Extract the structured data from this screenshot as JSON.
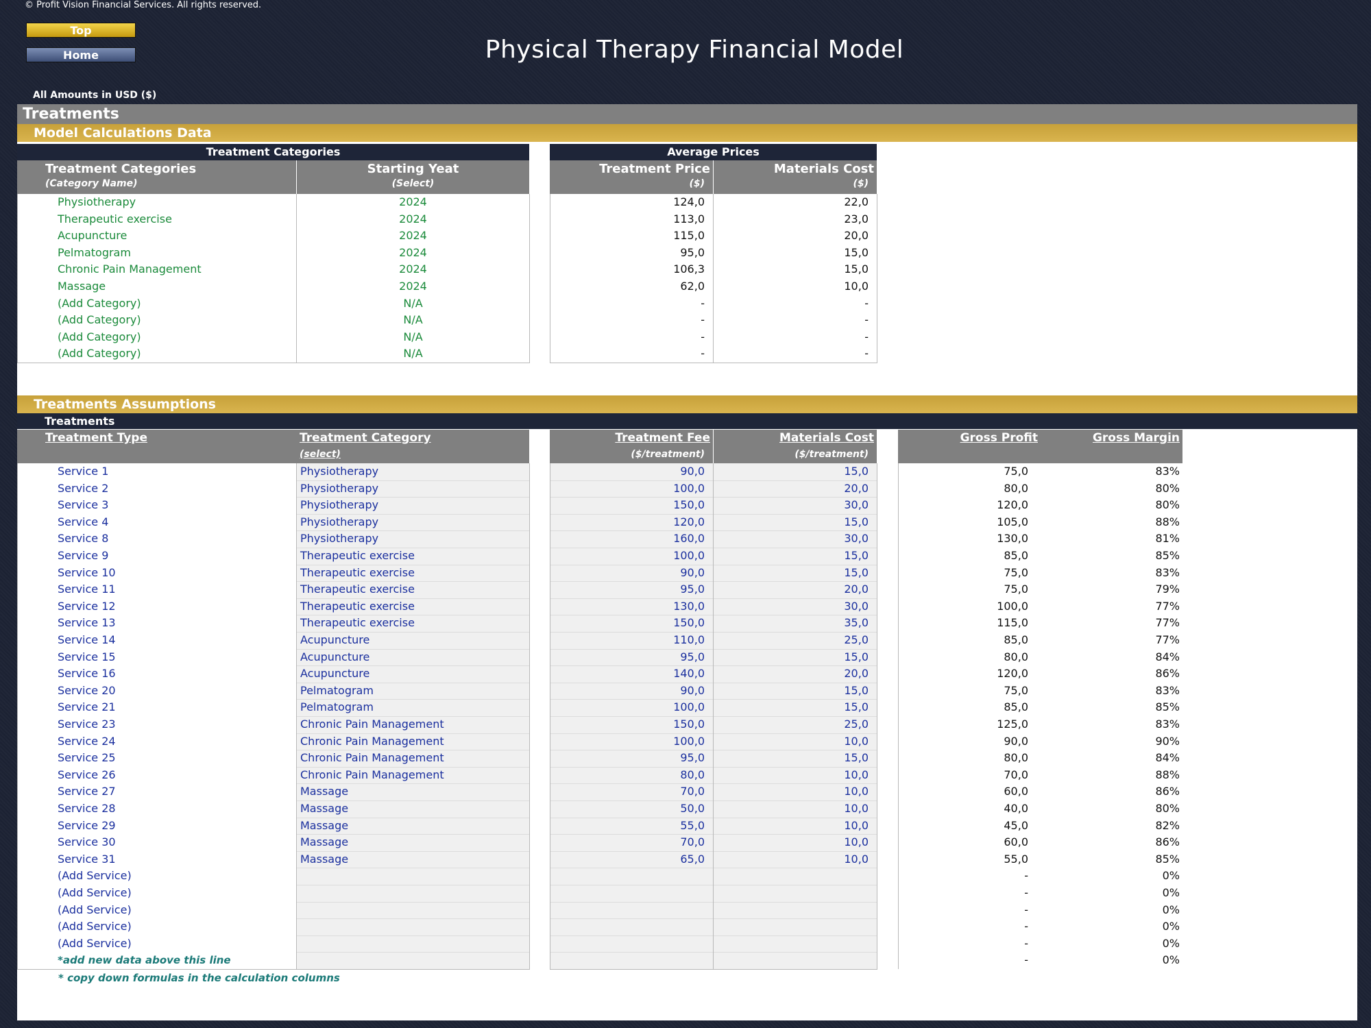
{
  "copyright": "© Profit Vision Financial Services. All rights reserved.",
  "nav": {
    "top_label": "Top",
    "home_label": "Home"
  },
  "title": "Physical Therapy Financial Model",
  "amounts_note": "All Amounts in  USD ($)",
  "section_title": "Treatments",
  "model_calc": {
    "bar_label": "Model Calculations Data",
    "group_categories": "Treatment Categories",
    "group_prices": "Average Prices",
    "col_category": "Treatment Categories",
    "col_category_sub": "(Category Name)",
    "col_year": "Starting Yeat",
    "col_year_sub": "(Select)",
    "col_price": "Treatment Price",
    "col_price_sub": "($)",
    "col_cost": "Materials Cost",
    "col_cost_sub": "($)",
    "rows": [
      {
        "name": "Physiotherapy",
        "year": "2024",
        "price": "124,0",
        "cost": "22,0"
      },
      {
        "name": "Therapeutic exercise",
        "year": "2024",
        "price": "113,0",
        "cost": "23,0"
      },
      {
        "name": "Acupuncture",
        "year": "2024",
        "price": "115,0",
        "cost": "20,0"
      },
      {
        "name": "Pelmatogram",
        "year": "2024",
        "price": "95,0",
        "cost": "15,0"
      },
      {
        "name": "Chronic Pain Management",
        "year": "2024",
        "price": "106,3",
        "cost": "15,0"
      },
      {
        "name": "Massage",
        "year": "2024",
        "price": "62,0",
        "cost": "10,0"
      },
      {
        "name": "(Add Category)",
        "year": "N/A",
        "price": "-",
        "cost": "-"
      },
      {
        "name": "(Add Category)",
        "year": "N/A",
        "price": "-",
        "cost": "-"
      },
      {
        "name": "(Add Category)",
        "year": "N/A",
        "price": "-",
        "cost": "-"
      },
      {
        "name": "(Add Category)",
        "year": "N/A",
        "price": "-",
        "cost": "-"
      }
    ]
  },
  "assumptions": {
    "bar_label": "Treatments Assumptions",
    "sub_bar_label": "Treatments",
    "col_type": "Treatment Type",
    "col_category": "Treatment Category",
    "col_category_sub": "(select)",
    "col_fee": "Treatment Fee",
    "col_fee_sub": "($/treatment)",
    "col_cost": "Materials Cost",
    "col_cost_sub": "($/treatment)",
    "col_profit": "Gross Profit",
    "col_margin": "Gross Margin",
    "rows": [
      {
        "type": "Service 1",
        "category": "Physiotherapy",
        "fee": "90,0",
        "cost": "15,0",
        "profit": "75,0",
        "margin": "83%"
      },
      {
        "type": "Service 2",
        "category": "Physiotherapy",
        "fee": "100,0",
        "cost": "20,0",
        "profit": "80,0",
        "margin": "80%"
      },
      {
        "type": "Service 3",
        "category": "Physiotherapy",
        "fee": "150,0",
        "cost": "30,0",
        "profit": "120,0",
        "margin": "80%"
      },
      {
        "type": "Service 4",
        "category": "Physiotherapy",
        "fee": "120,0",
        "cost": "15,0",
        "profit": "105,0",
        "margin": "88%"
      },
      {
        "type": "Service 8",
        "category": "Physiotherapy",
        "fee": "160,0",
        "cost": "30,0",
        "profit": "130,0",
        "margin": "81%"
      },
      {
        "type": "Service 9",
        "category": "Therapeutic exercise",
        "fee": "100,0",
        "cost": "15,0",
        "profit": "85,0",
        "margin": "85%"
      },
      {
        "type": "Service 10",
        "category": "Therapeutic exercise",
        "fee": "90,0",
        "cost": "15,0",
        "profit": "75,0",
        "margin": "83%"
      },
      {
        "type": "Service 11",
        "category": "Therapeutic exercise",
        "fee": "95,0",
        "cost": "20,0",
        "profit": "75,0",
        "margin": "79%"
      },
      {
        "type": "Service 12",
        "category": "Therapeutic exercise",
        "fee": "130,0",
        "cost": "30,0",
        "profit": "100,0",
        "margin": "77%"
      },
      {
        "type": "Service 13",
        "category": "Therapeutic exercise",
        "fee": "150,0",
        "cost": "35,0",
        "profit": "115,0",
        "margin": "77%"
      },
      {
        "type": "Service 14",
        "category": "Acupuncture",
        "fee": "110,0",
        "cost": "25,0",
        "profit": "85,0",
        "margin": "77%"
      },
      {
        "type": "Service 15",
        "category": "Acupuncture",
        "fee": "95,0",
        "cost": "15,0",
        "profit": "80,0",
        "margin": "84%"
      },
      {
        "type": "Service 16",
        "category": "Acupuncture",
        "fee": "140,0",
        "cost": "20,0",
        "profit": "120,0",
        "margin": "86%"
      },
      {
        "type": "Service 20",
        "category": "Pelmatogram",
        "fee": "90,0",
        "cost": "15,0",
        "profit": "75,0",
        "margin": "83%"
      },
      {
        "type": "Service 21",
        "category": "Pelmatogram",
        "fee": "100,0",
        "cost": "15,0",
        "profit": "85,0",
        "margin": "85%"
      },
      {
        "type": "Service 23",
        "category": "Chronic Pain Management",
        "fee": "150,0",
        "cost": "25,0",
        "profit": "125,0",
        "margin": "83%"
      },
      {
        "type": "Service 24",
        "category": "Chronic Pain Management",
        "fee": "100,0",
        "cost": "10,0",
        "profit": "90,0",
        "margin": "90%"
      },
      {
        "type": "Service 25",
        "category": "Chronic Pain Management",
        "fee": "95,0",
        "cost": "15,0",
        "profit": "80,0",
        "margin": "84%"
      },
      {
        "type": "Service 26",
        "category": "Chronic Pain Management",
        "fee": "80,0",
        "cost": "10,0",
        "profit": "70,0",
        "margin": "88%"
      },
      {
        "type": "Service 27",
        "category": "Massage",
        "fee": "70,0",
        "cost": "10,0",
        "profit": "60,0",
        "margin": "86%"
      },
      {
        "type": "Service 28",
        "category": "Massage",
        "fee": "50,0",
        "cost": "10,0",
        "profit": "40,0",
        "margin": "80%"
      },
      {
        "type": "Service 29",
        "category": "Massage",
        "fee": "55,0",
        "cost": "10,0",
        "profit": "45,0",
        "margin": "82%"
      },
      {
        "type": "Service 30",
        "category": "Massage",
        "fee": "70,0",
        "cost": "10,0",
        "profit": "60,0",
        "margin": "86%"
      },
      {
        "type": "Service 31",
        "category": "Massage",
        "fee": "65,0",
        "cost": "10,0",
        "profit": "55,0",
        "margin": "85%"
      },
      {
        "type": "(Add Service)",
        "category": "",
        "fee": "",
        "cost": "",
        "profit": "-",
        "margin": "0%"
      },
      {
        "type": "(Add Service)",
        "category": "",
        "fee": "",
        "cost": "",
        "profit": "-",
        "margin": "0%"
      },
      {
        "type": "(Add Service)",
        "category": "",
        "fee": "",
        "cost": "",
        "profit": "-",
        "margin": "0%"
      },
      {
        "type": "(Add Service)",
        "category": "",
        "fee": "",
        "cost": "",
        "profit": "-",
        "margin": "0%"
      },
      {
        "type": "(Add Service)",
        "category": "",
        "fee": "",
        "cost": "",
        "profit": "-",
        "margin": "0%"
      }
    ],
    "note_row": {
      "text": "*add new data above this line",
      "profit": "-",
      "margin": "0%"
    },
    "note_copy": "* copy down formulas in the calculation columns"
  },
  "colors": {
    "gold": "#c7a13a",
    "navy": "#1e2538",
    "gray_header": "#808080",
    "input_green": "#1a8a3a",
    "input_blue": "#1a2f9e",
    "note_teal": "#1b7a78"
  }
}
